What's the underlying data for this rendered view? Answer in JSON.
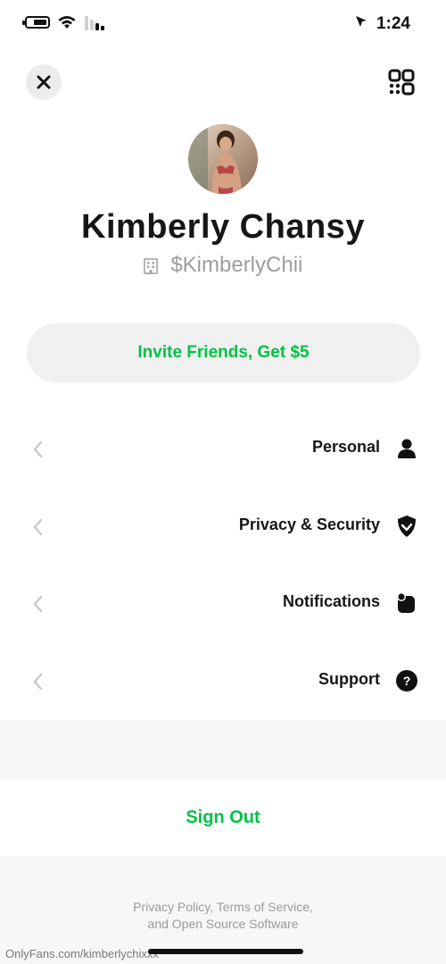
{
  "status_bar": {
    "time": "1:24"
  },
  "profile": {
    "name": "Kimberly Chansy",
    "cashtag": "$KimberlyChii"
  },
  "invite": {
    "label": "Invite Friends, Get $5"
  },
  "menu": {
    "items": [
      {
        "label": "Personal",
        "icon": "person-icon"
      },
      {
        "label": "Privacy & Security",
        "icon": "shield-icon"
      },
      {
        "label": "Notifications",
        "icon": "notification-icon"
      },
      {
        "label": "Support",
        "icon": "help-icon"
      }
    ]
  },
  "signout": {
    "label": "Sign Out"
  },
  "footer": {
    "legal_line1": "Privacy Policy, Terms of Service,",
    "legal_line2": "and Open Source Software"
  },
  "watermark": "OnlyFans.com/kimberlychixxx",
  "colors": {
    "accent": "#00c244",
    "text": "#161616",
    "muted": "#9d9d9d",
    "pill": "#f0f0f0"
  }
}
